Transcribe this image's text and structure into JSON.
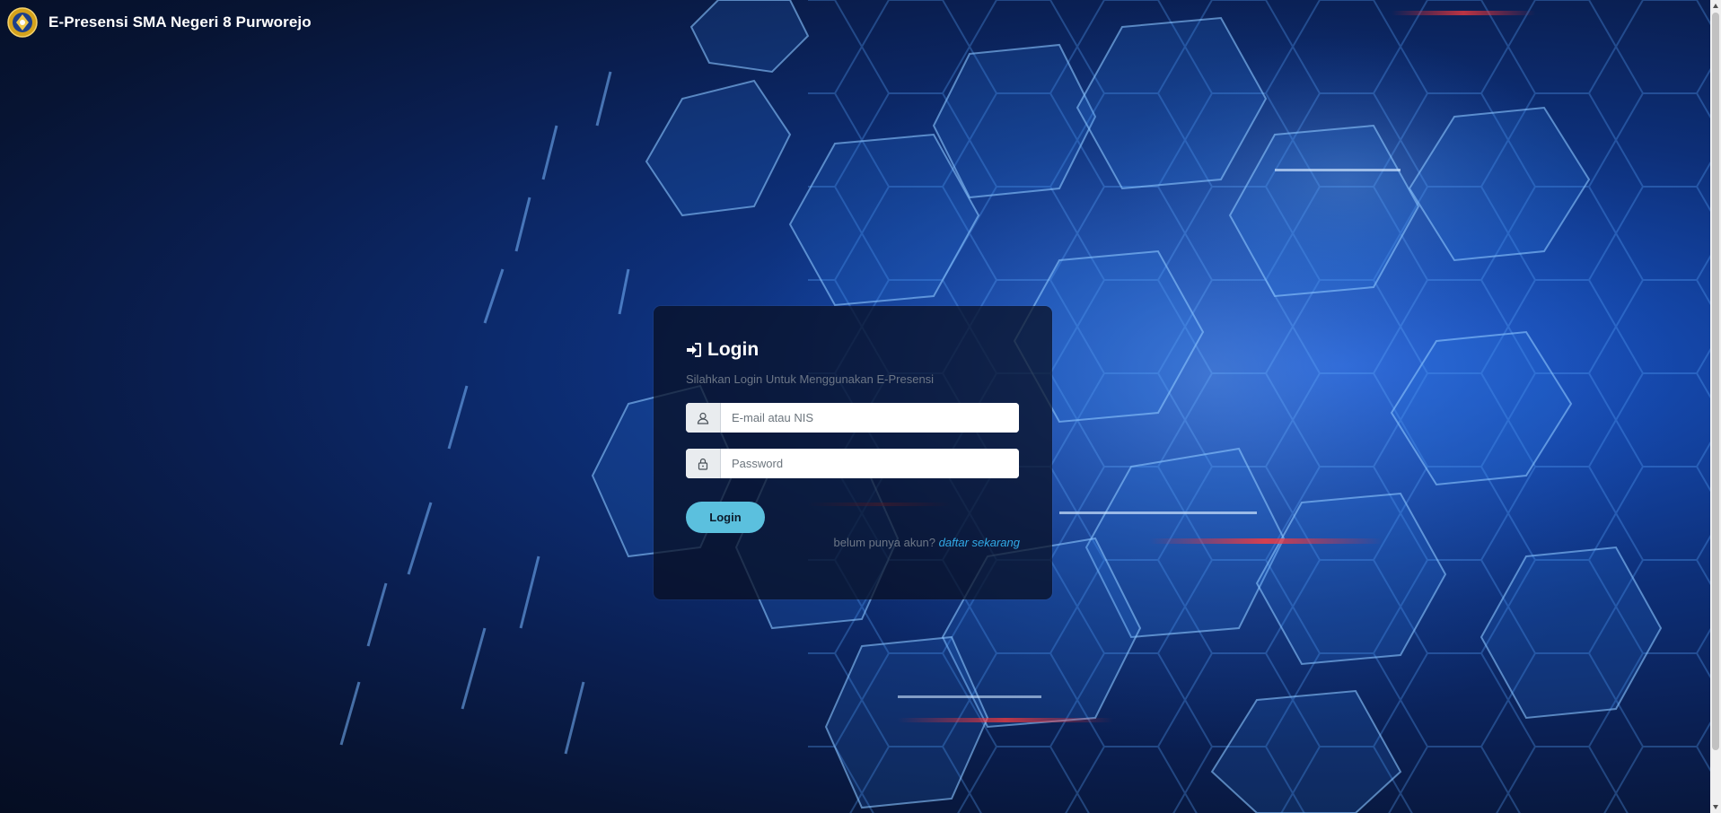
{
  "navbar": {
    "brand": "E-Presensi SMA Negeri 8 Purworejo",
    "logo_icon": "school-emblem-icon"
  },
  "login": {
    "title": "Login",
    "title_icon": "sign-in-icon",
    "subtitle": "Silahkan Login Untuk Menggunakan E-Presensi",
    "email": {
      "placeholder": "E-mail atau NIS",
      "value": "",
      "icon": "user-icon"
    },
    "password": {
      "placeholder": "Password",
      "value": "",
      "icon": "lock-icon"
    },
    "button_label": "Login",
    "register_prompt": "belum punya akun?",
    "register_link": "daftar sekarang"
  },
  "colors": {
    "button": "#5bc0de",
    "link": "#31a9e6",
    "subtitle": "#6c7686",
    "background": "#0a1f52"
  }
}
